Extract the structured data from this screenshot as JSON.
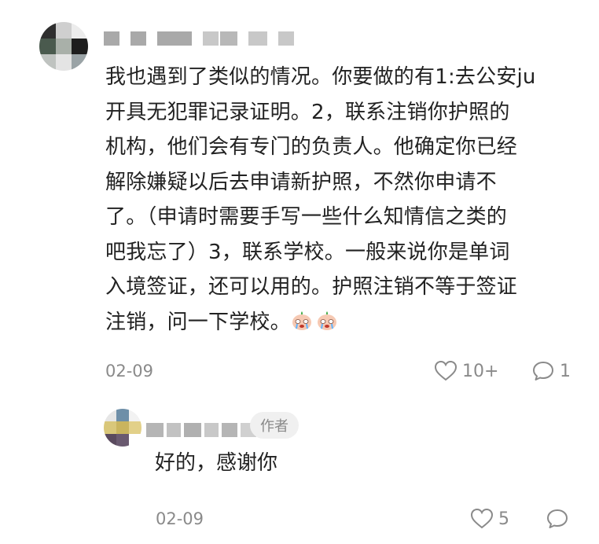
{
  "comment": {
    "lines": [
      "我也遇到了类似的情况。你要做的有1:去公安ju",
      "开具无犯罪记录证明。2，联系注销你护照的",
      "机构，他们会有专门的负责人。他确定你已经",
      "解除嫌疑以后去申请新护照，不然你申请不",
      "了。（申请时需要手写一些什么知情信之类的",
      "吧我忘了）3，联系学校。一般来说你是单词",
      "入境签证，还可以用的。护照注销不等于签证",
      "注销，问一下学校。"
    ],
    "emoji": [
      "crying-face-emoji",
      "crying-face-emoji"
    ],
    "date": "02-09",
    "like_count": "10+",
    "reply_count": "1"
  },
  "reply": {
    "author_badge": "作者",
    "text": "好的，感谢你",
    "date": "02-09",
    "like_count": "5",
    "reply_count": ""
  },
  "colors": {
    "text": "#222222",
    "meta": "#8a8a8a",
    "badge_bg": "#f0f0f0",
    "badge_text": "#888888",
    "censor": "#a9a9a9"
  },
  "icons": {
    "like": "heart-outline-icon",
    "comment": "speech-bubble-icon"
  }
}
